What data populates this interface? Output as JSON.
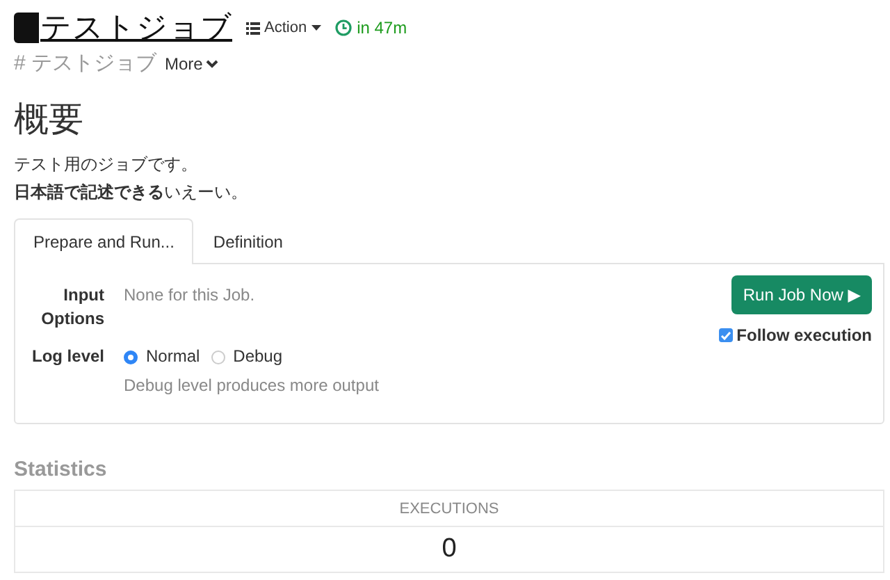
{
  "job": {
    "title": "テストジョブ",
    "action": "Action",
    "schedule": "in 47m",
    "group": "# テストジョブ",
    "more": "More"
  },
  "summary": {
    "heading": "概要",
    "lines": [
      "テスト用のジョブです。",
      "**日本語で記述できる**いえーい。"
    ]
  },
  "tabs": [
    {
      "label": "Prepare and Run...",
      "selected": true
    },
    {
      "label": "Definition",
      "selected": false
    }
  ],
  "form": {
    "input_options_label": "Input Options",
    "input_options_value": "None for this Job.",
    "log_level_label": "Log level",
    "log_levels": [
      {
        "label": "Normal",
        "selected": true
      },
      {
        "label": "Debug",
        "selected": false
      }
    ],
    "log_level_help": "Debug level produces more output"
  },
  "run_button": "Run Job Now ▶",
  "follow_execution": {
    "label": "Follow execution",
    "checked": true
  },
  "statistics": {
    "heading": "Statistics",
    "columns": [
      "EXECUTIONS"
    ],
    "values": [
      "0"
    ]
  }
}
